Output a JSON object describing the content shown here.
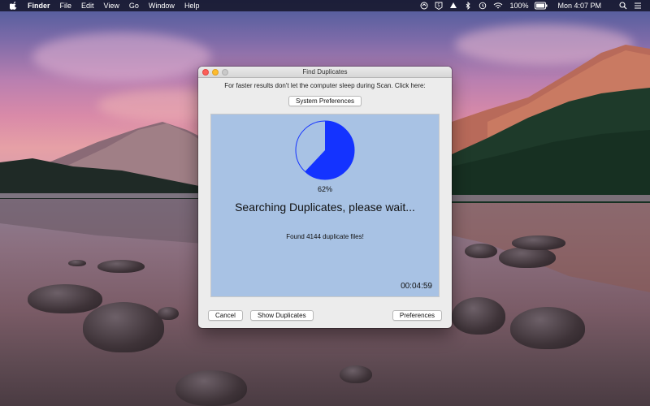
{
  "menubar": {
    "app_name": "Finder",
    "items": [
      "File",
      "Edit",
      "View",
      "Go",
      "Window",
      "Help"
    ],
    "battery": "100%",
    "clock": "Mon 4:07 PM",
    "icons": [
      "apple-icon",
      "refresh-icon",
      "five-badge-icon",
      "drive-icon",
      "bluetooth-icon",
      "history-icon",
      "wifi-icon",
      "battery-icon",
      "search-icon",
      "list-icon"
    ]
  },
  "window": {
    "title": "Find Duplicates",
    "hint": "For faster results don't let the computer sleep during Scan. Click here:",
    "system_prefs_label": "System Preferences",
    "progress": {
      "fraction": 0.62,
      "percent_label": "62%",
      "fill_color": "#1433ff",
      "bg_color": "#a8c2e4"
    },
    "status": "Searching Duplicates, please wait...",
    "found": "Found 4144 duplicate files!",
    "elapsed": "00:04:59",
    "buttons": {
      "cancel": "Cancel",
      "show_duplicates": "Show Duplicates",
      "preferences": "Preferences"
    }
  }
}
